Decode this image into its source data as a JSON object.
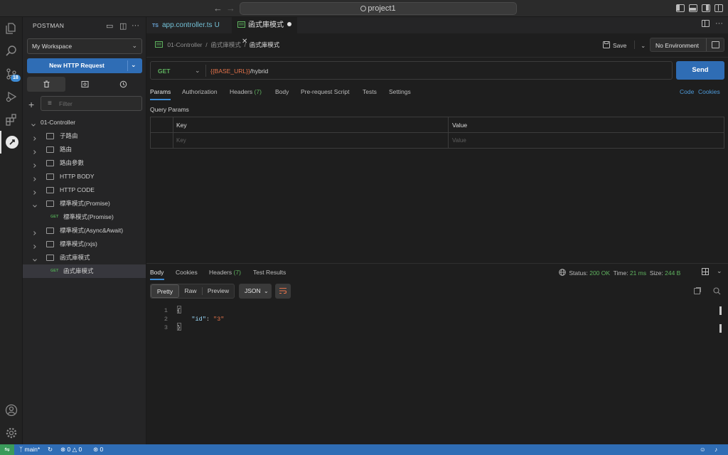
{
  "titlebar": {
    "back_icon": "arrow-left-icon",
    "forward_icon": "arrow-right-icon",
    "search_text": "project1"
  },
  "activity": {
    "scm_badge": "18"
  },
  "sidebar": {
    "title": "POSTMAN",
    "workspace": "My Workspace",
    "new_request": "New HTTP Request",
    "filter_placeholder": "Filter",
    "tree": [
      {
        "type": "collection",
        "label": "01-Controller",
        "expanded": true
      },
      {
        "type": "folder",
        "label": "子路由",
        "expanded": false
      },
      {
        "type": "folder",
        "label": "路由",
        "expanded": false
      },
      {
        "type": "folder",
        "label": "路由參數",
        "expanded": false
      },
      {
        "type": "folder",
        "label": "HTTP BODY",
        "expanded": false
      },
      {
        "type": "folder",
        "label": "HTTP CODE",
        "expanded": false
      },
      {
        "type": "folder",
        "label": "標準模式(Promise)",
        "expanded": true
      },
      {
        "type": "request",
        "method": "GET",
        "label": "標準模式(Promise)"
      },
      {
        "type": "folder",
        "label": "標準模式(Async&Await)",
        "expanded": false
      },
      {
        "type": "folder",
        "label": "標準模式(rxjs)",
        "expanded": false
      },
      {
        "type": "folder",
        "label": "函式庫模式",
        "expanded": true
      },
      {
        "type": "request",
        "method": "GET",
        "label": "函式庫模式",
        "selected": true
      }
    ]
  },
  "tabs": {
    "file_tab": {
      "icon": "TS",
      "name": "app.controller.ts",
      "status": "U"
    },
    "request_tab": {
      "name": "函式庫模式"
    }
  },
  "request": {
    "breadcrumb": [
      "01-Controller",
      "函式庫模式",
      "函式庫模式"
    ],
    "save_label": "Save",
    "environment": "No Environment",
    "method": "GET",
    "url_var": "{{BASE_URL}}",
    "url_path": "/hybrid",
    "send_label": "Send",
    "tabs": {
      "params": "Params",
      "authorization": "Authorization",
      "headers": "Headers",
      "headers_count": "(7)",
      "body": "Body",
      "prerequest": "Pre-request Script",
      "tests": "Tests",
      "settings": "Settings"
    },
    "links": {
      "code": "Code",
      "cookies": "Cookies"
    },
    "query_params_title": "Query Params",
    "table": {
      "key_header": "Key",
      "value_header": "Value",
      "key_placeholder": "Key",
      "value_placeholder": "Value"
    }
  },
  "response": {
    "tabs": {
      "body": "Body",
      "cookies": "Cookies",
      "headers": "Headers",
      "headers_count": "(7)",
      "test_results": "Test Results"
    },
    "status_label": "Status:",
    "status_value": "200 OK",
    "time_label": "Time:",
    "time_value": "21 ms",
    "size_label": "Size:",
    "size_value": "244 B",
    "formats": {
      "pretty": "Pretty",
      "raw": "Raw",
      "preview": "Preview"
    },
    "language": "JSON",
    "code": {
      "l1": "1",
      "l2": "2",
      "l3": "3",
      "open": "{",
      "key": "\"id\"",
      "colon": ": ",
      "value": "\"3\"",
      "close": "}"
    }
  },
  "statusbar": {
    "branch": "main*",
    "errors": "0",
    "warnings": "0",
    "ports": "0"
  },
  "colors": {
    "accent": "#2f6db5",
    "get_method": "#5fb35f",
    "variable": "#e5734a",
    "status_ok": "#5fb35f"
  }
}
